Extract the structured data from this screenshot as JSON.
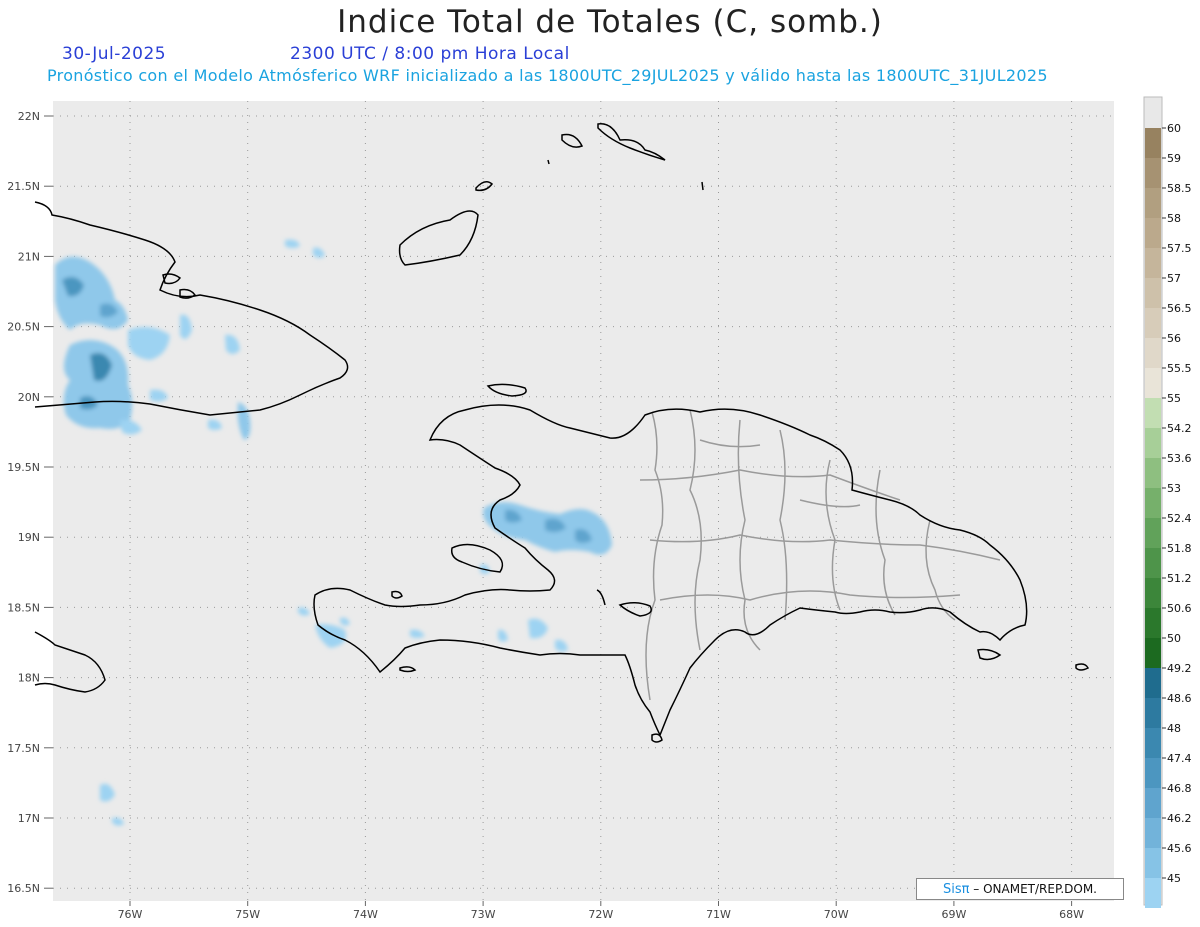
{
  "header": {
    "title": "Indice Total de Totales (C, somb.)",
    "date": "30-Jul-2025",
    "time": "2300 UTC / 8:00 pm Hora Local",
    "subtitle": "Pronóstico con el Modelo Atmósferico WRF inicializado a las 1800UTC_29JUL2025 y válido hasta las  1800UTC_31JUL2025"
  },
  "axes": {
    "lat_labels": [
      "22N",
      "21.5N",
      "21N",
      "20.5N",
      "20N",
      "19.5N",
      "19N",
      "18.5N",
      "18N",
      "17.5N",
      "17N",
      "16.5N"
    ],
    "lon_labels": [
      "76W",
      "75W",
      "74W",
      "73W",
      "72W",
      "71W",
      "70W",
      "69W",
      "68W"
    ]
  },
  "colorbar": {
    "labels": [
      "60",
      "59",
      "58.5",
      "58",
      "57.5",
      "57",
      "56.5",
      "56",
      "55.5",
      "55",
      "54.2",
      "53.6",
      "53",
      "52.4",
      "51.8",
      "51.2",
      "50.6",
      "50",
      "49.2",
      "48.6",
      "48",
      "47.4",
      "46.8",
      "46.2",
      "45.6",
      "45"
    ],
    "colors": [
      "#978260",
      "#a69272",
      "#b19f80",
      "#bba98c",
      "#c5b59b",
      "#cec1aa",
      "#d7ccb9",
      "#e0d8c9",
      "#e9e4d8",
      "#c2deb2",
      "#a7cf98",
      "#8ebf80",
      "#76b06b",
      "#61a25a",
      "#4e944a",
      "#3c863a",
      "#2b782c",
      "#1c6a20",
      "#1f6c8e",
      "#2d7aa0",
      "#3b88b0",
      "#4c96c0",
      "#5fa4ce",
      "#72b3da",
      "#86c3e6",
      "#9dd3f2"
    ]
  },
  "credit": {
    "brand": "Sisπ",
    "text": "– ONAMET/REP.DOM."
  },
  "colors": {
    "background": "#ebebeb",
    "title_blue": "#2a3fd6",
    "subtitle_cyan": "#1aa3e0",
    "coast": "#000000",
    "provinces": "#999999"
  }
}
